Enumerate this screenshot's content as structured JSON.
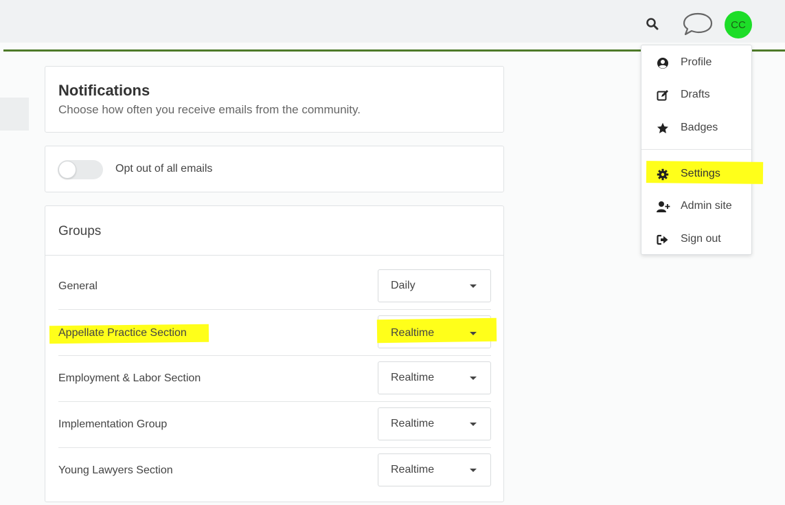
{
  "header": {
    "icons": [
      "search-icon",
      "chat-bubble-icon"
    ],
    "avatar_initials": "CC",
    "accent_line_color": "#4d7a28",
    "avatar_color": "#1ddd28"
  },
  "notifications": {
    "title": "Notifications",
    "subtitle": "Choose how often you receive emails from the community."
  },
  "optout": {
    "label": "Opt out of all emails",
    "enabled": false
  },
  "groups": {
    "title": "Groups",
    "rows": [
      {
        "name": "General",
        "frequency": "Daily",
        "highlighted": false
      },
      {
        "name": "Appellate Practice Section",
        "frequency": "Realtime",
        "highlighted": true
      },
      {
        "name": "Employment & Labor Section",
        "frequency": "Realtime",
        "highlighted": false
      },
      {
        "name": "Implementation Group",
        "frequency": "Realtime",
        "highlighted": false
      },
      {
        "name": "Young Lawyers Section",
        "frequency": "Realtime",
        "highlighted": false
      }
    ]
  },
  "user_menu": {
    "items": [
      {
        "label": "Profile",
        "icon": "user-circle-icon"
      },
      {
        "label": "Drafts",
        "icon": "edit-icon"
      },
      {
        "label": "Badges",
        "icon": "star-icon"
      },
      {
        "label": "Settings",
        "icon": "gear-icon",
        "highlighted": true
      },
      {
        "label": "Admin site",
        "icon": "user-plus-icon"
      },
      {
        "label": "Sign out",
        "icon": "sign-out-icon"
      }
    ]
  },
  "highlight_color": "#ffff1a"
}
